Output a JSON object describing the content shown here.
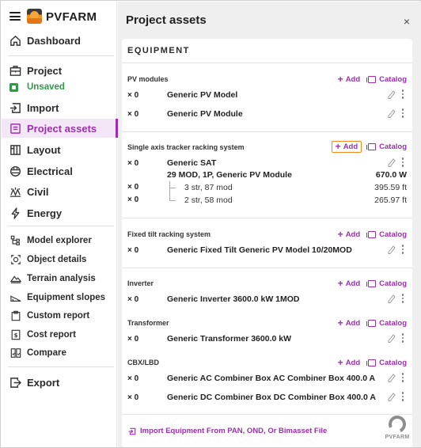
{
  "brand": {
    "name": "PVFARM"
  },
  "nav": {
    "dashboard": "Dashboard",
    "project": "Project",
    "unsaved": "Unsaved",
    "import": "Import",
    "project_assets": "Project assets",
    "layout": "Layout",
    "electrical": "Electrical",
    "civil": "Civil",
    "energy": "Energy",
    "model_explorer": "Model explorer",
    "object_details": "Object details",
    "terrain_analysis": "Terrain analysis",
    "equipment_slopes": "Equipment slopes",
    "custom_report": "Custom report",
    "cost_report": "Cost report",
    "compare": "Compare",
    "export": "Export"
  },
  "panel": {
    "title": "Project assets",
    "close": "×",
    "section_header": "EQUIPMENT",
    "add_label": "Add",
    "catalog_label": "Catalog",
    "sections": {
      "pv": {
        "title": "PV modules",
        "items": [
          {
            "qty": "× 0",
            "name": "Generic PV Model"
          },
          {
            "qty": "× 0",
            "name": "Generic PV Module"
          }
        ]
      },
      "tracker": {
        "title": "Single axis tracker racking system",
        "item": {
          "qty": "× 0",
          "name": "Generic SAT"
        },
        "detail": {
          "desc": "29 MOD, 1P, Generic PV Module",
          "value": "670.0 W"
        },
        "subs": [
          {
            "qty": "× 0",
            "desc": "3 str, 87 mod",
            "value": "395.59 ft"
          },
          {
            "qty": "× 0",
            "desc": "2 str, 58 mod",
            "value": "265.97 ft"
          }
        ]
      },
      "fixed": {
        "title": "Fixed tilt racking system",
        "item": {
          "qty": "× 0",
          "name": "Generic Fixed Tilt Generic PV Model 10/20MOD"
        }
      },
      "inverter": {
        "title": "Inverter",
        "item": {
          "qty": "× 0",
          "name": "Generic Inverter 3600.0 kW 1MOD"
        }
      },
      "transformer": {
        "title": "Transformer",
        "item": {
          "qty": "× 0",
          "name": "Generic Transformer 3600.0 kW"
        }
      },
      "cbx": {
        "title": "CBX/LBD",
        "items": [
          {
            "qty": "× 0",
            "name": "Generic AC Combiner Box AC Combiner Box 400.0 A"
          },
          {
            "qty": "× 0",
            "name": "Generic DC Combiner Box DC Combiner Box 400.0 A"
          }
        ]
      }
    },
    "import_link": "Import Equipment From PAN, OND, Or Bimasset File",
    "badge_text": "PVFARM"
  },
  "colors": {
    "accent": "#9b2fae",
    "success": "#2e9a48",
    "highlight": "#f28a1d"
  }
}
